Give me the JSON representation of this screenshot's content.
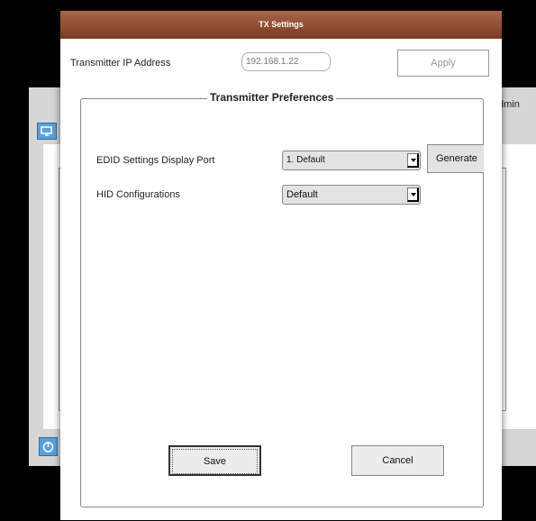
{
  "background": {
    "admin_label": "dmin"
  },
  "dialog": {
    "title": "TX Settings",
    "ip_label": "Transmitter IP Address",
    "ip_placeholder": "192.168.1.22",
    "apply_label": "Apply",
    "group_title": "Transmitter Preferences",
    "edid_label": "EDID Settings Display Port",
    "edid_value": "1. Default",
    "generate_label": "Generate",
    "hid_label": "HID Configurations",
    "hid_value": "Default",
    "save_label": "Save",
    "cancel_label": "Cancel"
  },
  "colors": {
    "titlebar": "#8a4a30",
    "icon_blue": "#5aa0d8"
  }
}
